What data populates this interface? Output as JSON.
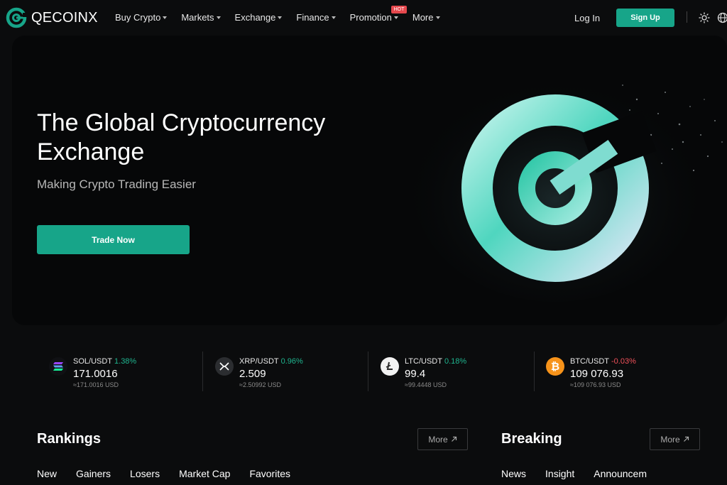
{
  "brand": {
    "name": "QECOINX",
    "accent": "#17a589"
  },
  "nav": {
    "items": [
      {
        "label": "Buy Crypto"
      },
      {
        "label": "Markets"
      },
      {
        "label": "Exchange"
      },
      {
        "label": "Finance"
      },
      {
        "label": "Promotion",
        "badge": "HOT"
      },
      {
        "label": "More"
      }
    ],
    "login": "Log In",
    "signup": "Sign Up",
    "icons": [
      "sun-icon",
      "globe-icon"
    ]
  },
  "hero": {
    "title": "The Global Cryptocurrency Exchange",
    "subtitle": "Making Crypto Trading Easier",
    "cta": "Trade Now"
  },
  "tickers": [
    {
      "pair": "SOL/USDT",
      "change": "1.38%",
      "price": "171.0016",
      "usd": "≈171.0016 USD",
      "icon": "sol-icon"
    },
    {
      "pair": "XRP/USDT",
      "change": "0.96%",
      "price": "2.509",
      "usd": "≈2.50992 USD",
      "icon": "xrp-icon"
    },
    {
      "pair": "LTC/USDT",
      "change": "0.18%",
      "price": "99.4",
      "usd": "≈99.4448 USD",
      "icon": "ltc-icon"
    },
    {
      "pair": "BTC/USDT",
      "change": "-0.03%",
      "price": "109 076.93",
      "usd": "≈109 076.93 USD",
      "icon": "btc-icon"
    }
  ],
  "rankings": {
    "title": "Rankings",
    "more": "More",
    "tabs": [
      "New",
      "Gainers",
      "Losers",
      "Market Cap",
      "Favorites"
    ]
  },
  "breaking": {
    "title": "Breaking",
    "more": "More",
    "tabs": [
      "News",
      "Insight",
      "Announcem"
    ]
  }
}
